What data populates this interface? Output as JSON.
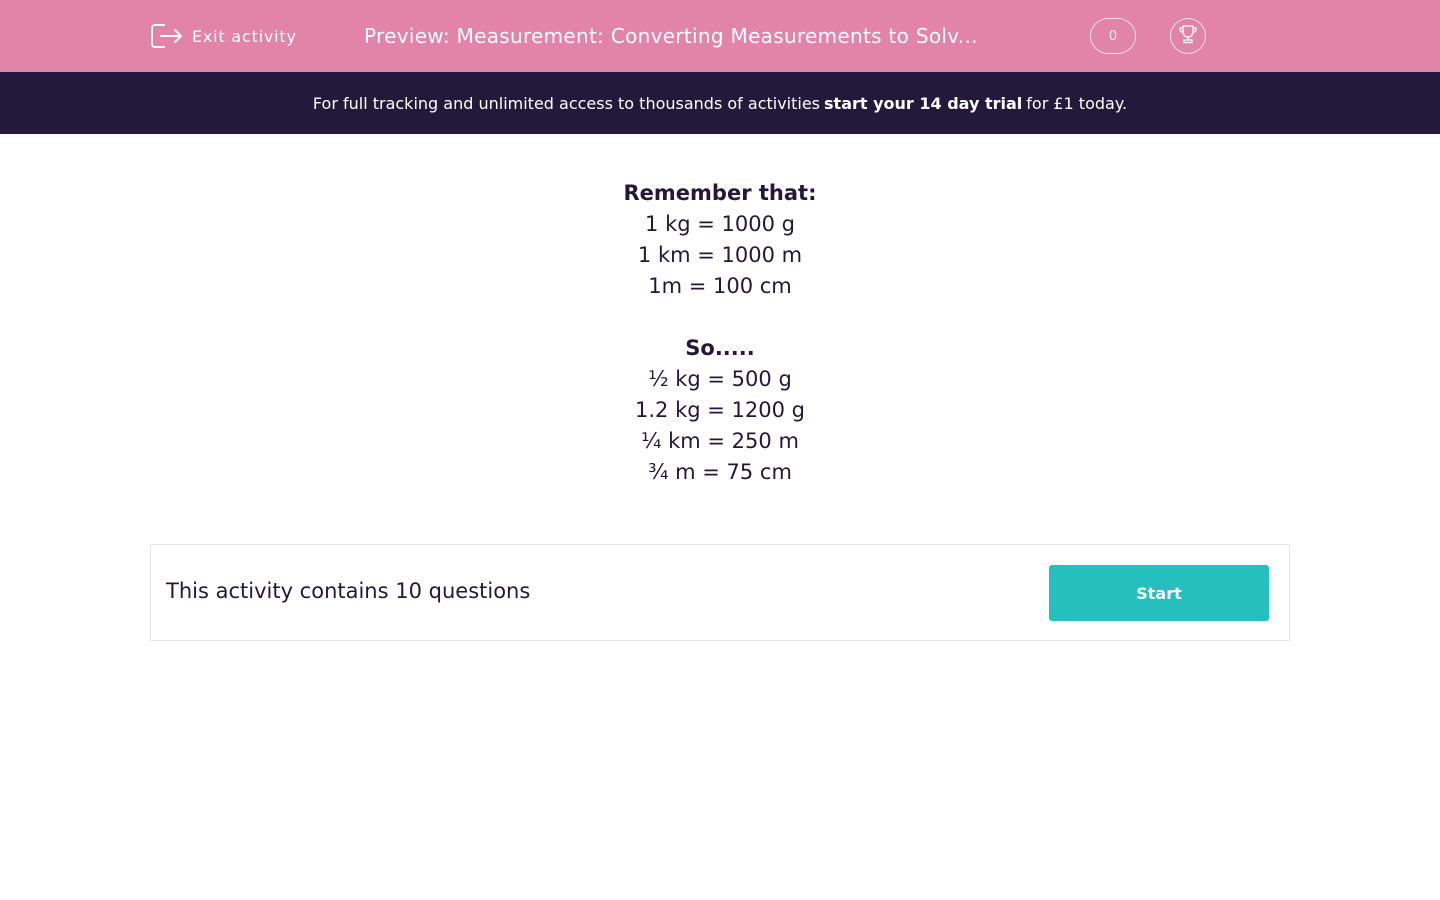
{
  "header": {
    "exit_label": "Exit activity",
    "title": "Preview: Measurement: Converting Measurements to Solv...",
    "score": "0",
    "exit_icon": "exit-icon",
    "trophy_icon": "trophy-icon",
    "background_color": "#e284a7"
  },
  "banner": {
    "text_before": "For full tracking and unlimited access to thousands of activities",
    "link_text": "start your 14 day trial",
    "text_after": "for £1 today.",
    "background_color": "#231a3b"
  },
  "intro": {
    "heading1": "Remember that:",
    "facts": [
      "1 kg = 1000 g",
      "1 km = 1000 m",
      "1m = 100 cm"
    ],
    "heading2": "So.....",
    "examples": [
      "½ kg = 500 g",
      "1.2 kg = 1200 g",
      "¼ km = 250 m",
      "¾ m = 75 cm"
    ]
  },
  "activity": {
    "count_text": "This activity contains 10 questions",
    "start_label": "Start",
    "button_color": "#25bfbe"
  }
}
